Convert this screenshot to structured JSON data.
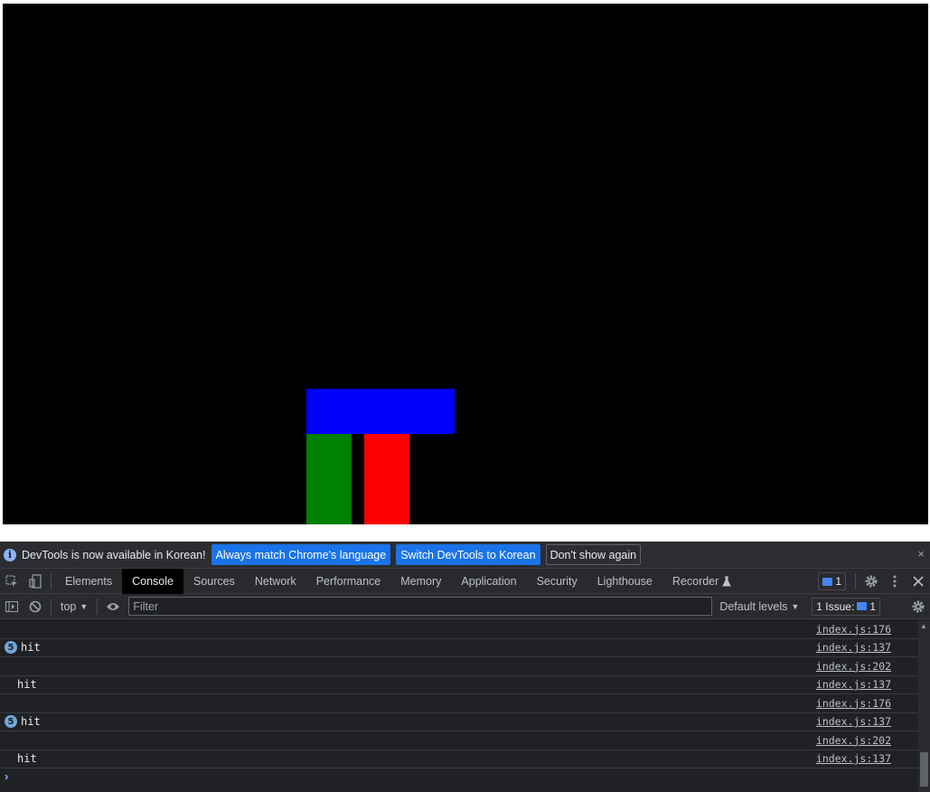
{
  "game": {
    "background_color": "#000000",
    "blocks": [
      {
        "name": "blue",
        "color": "#0000ff"
      },
      {
        "name": "green",
        "color": "#008000"
      },
      {
        "name": "red",
        "color": "#ff0000"
      }
    ]
  },
  "devtools": {
    "infobar": {
      "message": "DevTools is now available in Korean!",
      "btn_match": "Always match Chrome's language",
      "btn_switch": "Switch DevTools to Korean",
      "btn_dismiss": "Don't show again",
      "close": "×"
    },
    "tabs": [
      "Elements",
      "Console",
      "Sources",
      "Network",
      "Performance",
      "Memory",
      "Application",
      "Security",
      "Lighthouse",
      "Recorder"
    ],
    "active_tab": "Console",
    "issues_count": "1",
    "toolbar": {
      "context": "top",
      "filter_placeholder": "Filter",
      "levels": "Default levels",
      "issues_label": "1 Issue:",
      "issues_count": "1"
    },
    "console_rows": [
      {
        "count": "",
        "message": "",
        "source": "index.js:176"
      },
      {
        "count": "5",
        "message": "hit",
        "source": "index.js:137"
      },
      {
        "count": "",
        "message": "",
        "source": "index.js:202"
      },
      {
        "count": "",
        "message": "hit",
        "source": "index.js:137"
      },
      {
        "count": "",
        "message": "",
        "source": "index.js:176"
      },
      {
        "count": "5",
        "message": "hit",
        "source": "index.js:137"
      },
      {
        "count": "",
        "message": "",
        "source": "index.js:202"
      },
      {
        "count": "",
        "message": "hit",
        "source": "index.js:137"
      }
    ],
    "prompt_symbol": "›"
  }
}
